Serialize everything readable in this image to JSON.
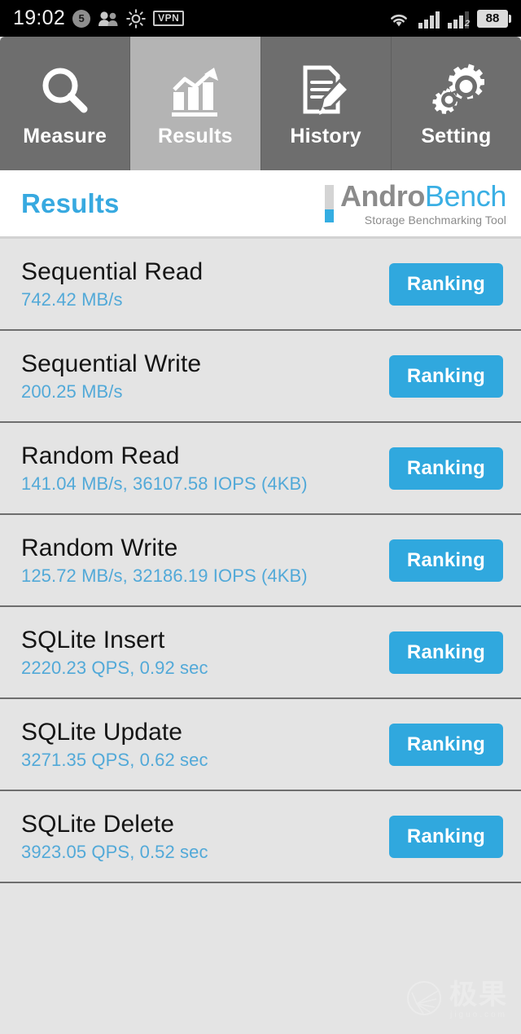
{
  "statusbar": {
    "time": "19:02",
    "notification_count": "5",
    "contacts_icon": "contacts-icon",
    "brightness_icon": "brightness-icon",
    "vpn_label": "VPN",
    "wifi_icon": "wifi-icon",
    "signal1_icon": "signal-bars-icon",
    "signal2_icon": "signal-bars-icon",
    "signal2_sim_label": "2",
    "battery_level": "88"
  },
  "tabs": [
    {
      "label": "Measure",
      "icon": "magnifier-icon",
      "active": false
    },
    {
      "label": "Results",
      "icon": "bar-chart-icon",
      "active": true
    },
    {
      "label": "History",
      "icon": "document-pencil-icon",
      "active": false
    },
    {
      "label": "Setting",
      "icon": "gears-icon",
      "active": false
    }
  ],
  "header": {
    "title": "Results",
    "brand_first": "Andro",
    "brand_second": "Bench",
    "tagline": "Storage Benchmarking Tool"
  },
  "colors": {
    "accent_blue": "#30a8de",
    "title_blue": "#37a9e0",
    "subtitle_blue": "#52a9d8",
    "tab_inactive": "#6e6e6e",
    "tab_active": "#b4b4b4",
    "list_bg": "#e4e4e4"
  },
  "results": [
    {
      "title": "Sequential Read",
      "value": "742.42 MB/s",
      "button": "Ranking"
    },
    {
      "title": "Sequential Write",
      "value": "200.25 MB/s",
      "button": "Ranking"
    },
    {
      "title": "Random Read",
      "value": "141.04 MB/s, 36107.58 IOPS (4KB)",
      "button": "Ranking"
    },
    {
      "title": "Random Write",
      "value": "125.72 MB/s, 32186.19 IOPS (4KB)",
      "button": "Ranking"
    },
    {
      "title": "SQLite Insert",
      "value": "2220.23 QPS, 0.92 sec",
      "button": "Ranking"
    },
    {
      "title": "SQLite Update",
      "value": "3271.35 QPS, 0.62 sec",
      "button": "Ranking"
    },
    {
      "title": "SQLite Delete",
      "value": "3923.05 QPS, 0.52 sec",
      "button": "Ranking"
    }
  ],
  "watermark": {
    "cn": "极果",
    "en": "jiguo.com"
  }
}
